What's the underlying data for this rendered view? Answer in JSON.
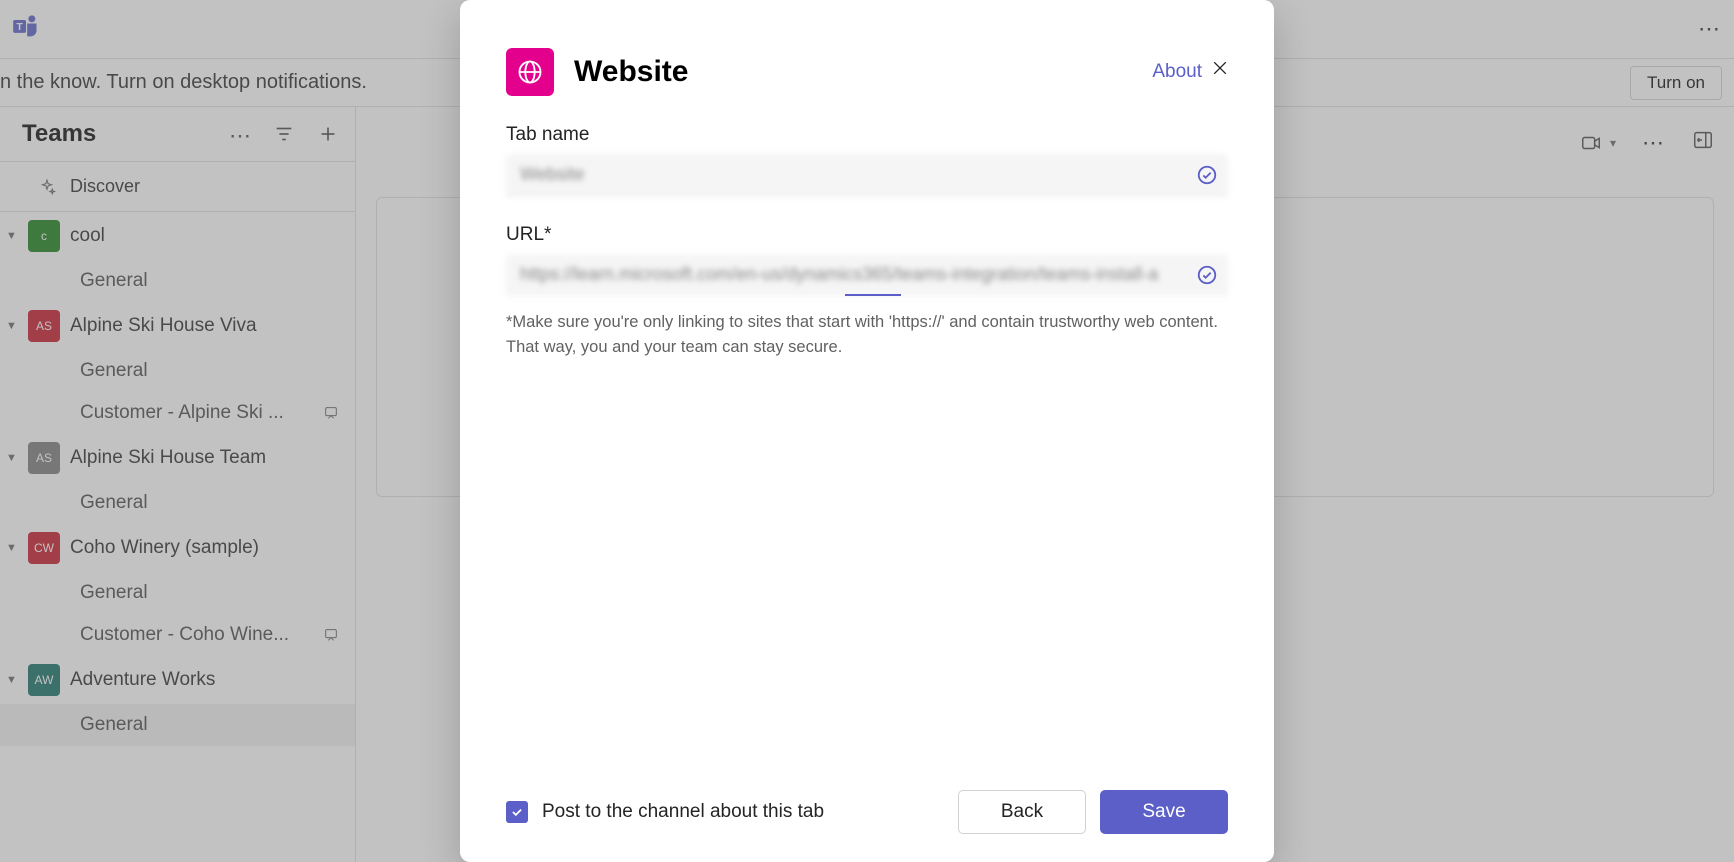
{
  "topbar": {
    "more_label": "More options"
  },
  "notif": {
    "text": "n the know. Turn on desktop notifications.",
    "turn_on": "Turn on"
  },
  "sidebar": {
    "title": "Teams",
    "discover": "Discover",
    "teams": [
      {
        "name": "cool",
        "avatar_bg": "#107c10",
        "avatar_text": "c",
        "channels": [
          "General"
        ]
      },
      {
        "name": "Alpine Ski House Viva",
        "avatar_bg": "#c50f1f",
        "avatar_text": "AS",
        "channels": [
          "General",
          "Customer - Alpine Ski ..."
        ]
      },
      {
        "name": "Alpine Ski House Team",
        "avatar_bg": "#777777",
        "avatar_text": "AS",
        "channels": [
          "General"
        ]
      },
      {
        "name": "Coho Winery (sample)",
        "avatar_bg": "#c50f1f",
        "avatar_text": "CW",
        "channels": [
          "General",
          "Customer - Coho Wine..."
        ]
      },
      {
        "name": "Adventure Works",
        "avatar_bg": "#0b6a5f",
        "avatar_text": "AW",
        "channels": [
          "General"
        ]
      }
    ]
  },
  "dialog": {
    "title": "Website",
    "about": "About",
    "tab_name_label": "Tab name",
    "tab_name_value": "Website",
    "url_label": "URL*",
    "url_value": "https://learn.microsoft.com/en-us/dynamics365/teams-integration/teams-install-a",
    "helper": "*Make sure you're only linking to sites that start with 'https://' and contain trustworthy web content. That way, you and your team can stay secure.",
    "post_checkbox_label": "Post to the channel about this tab",
    "back": "Back",
    "save": "Save"
  }
}
